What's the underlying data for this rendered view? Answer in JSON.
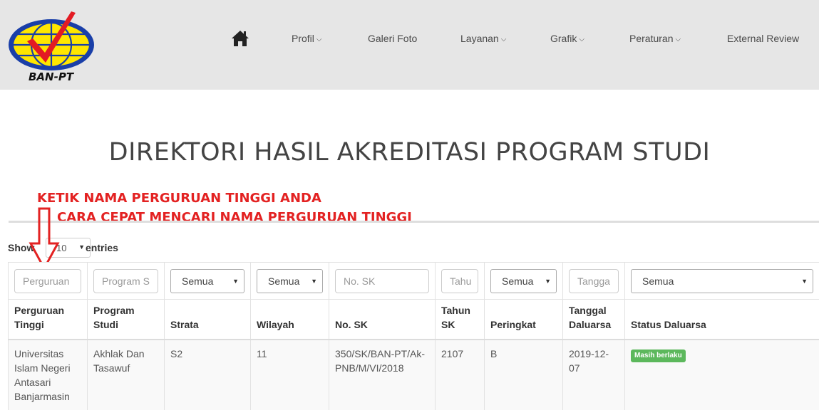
{
  "header": {
    "logo_text": "BAN-PT",
    "nav": [
      {
        "label": "Profil",
        "has_dropdown": true
      },
      {
        "label": "Galeri Foto",
        "has_dropdown": false
      },
      {
        "label": "Layanan",
        "has_dropdown": true
      },
      {
        "label": "Grafik",
        "has_dropdown": true
      },
      {
        "label": "Peraturan",
        "has_dropdown": true
      },
      {
        "label": "External Review",
        "has_dropdown": false
      }
    ],
    "chevron": "⌵"
  },
  "page_title": "DIREKTORI HASIL AKREDITASI PROGRAM STUDI",
  "annotations": {
    "line1": "KETIK NAMA PERGURUAN TINGGI ANDA",
    "line2": "CARA CEPAT MENCARI NAMA PERGURUAN TINGGI",
    "color": "#e32222"
  },
  "length_control": {
    "show_label": "Show",
    "value": "10",
    "entries_label": "entries"
  },
  "filters": {
    "perguruan_placeholder": "Perguruan",
    "program_placeholder": "Program S",
    "strata_value": "Semua",
    "wilayah_value": "Semua",
    "no_sk_placeholder": "No. SK",
    "tahun_placeholder": "Tahu",
    "peringkat_value": "Semua",
    "tanggal_placeholder": "Tangga",
    "status_value": "Semua"
  },
  "columns": {
    "perguruan_1": "Perguruan",
    "perguruan_2": "Tinggi",
    "program_1": "Program",
    "program_2": "Studi",
    "strata": "Strata",
    "wilayah": "Wilayah",
    "no_sk": "No. SK",
    "tahun_1": "Tahun",
    "tahun_2": "SK",
    "peringkat": "Peringkat",
    "tanggal_1": "Tanggal",
    "tanggal_2": "Daluarsa",
    "status": "Status Daluarsa"
  },
  "rows": [
    {
      "perguruan_lines": [
        "Universitas",
        "Islam Negeri",
        "Antasari",
        "Banjarmasin"
      ],
      "program_lines": [
        "Akhlak Dan",
        "Tasawuf"
      ],
      "strata": "S2",
      "wilayah": "11",
      "no_sk_lines": [
        "350/SK/BAN-PT/Ak-",
        "PNB/M/VI/2018"
      ],
      "tahun_sk": "2107",
      "peringkat": "B",
      "tanggal_lines": [
        "2019-12-",
        "07"
      ],
      "status": "Masih berlaku"
    }
  ],
  "colors": {
    "header_bg": "#e6e6e6",
    "badge_bg": "#5cb85c",
    "annotation": "#e32222"
  }
}
